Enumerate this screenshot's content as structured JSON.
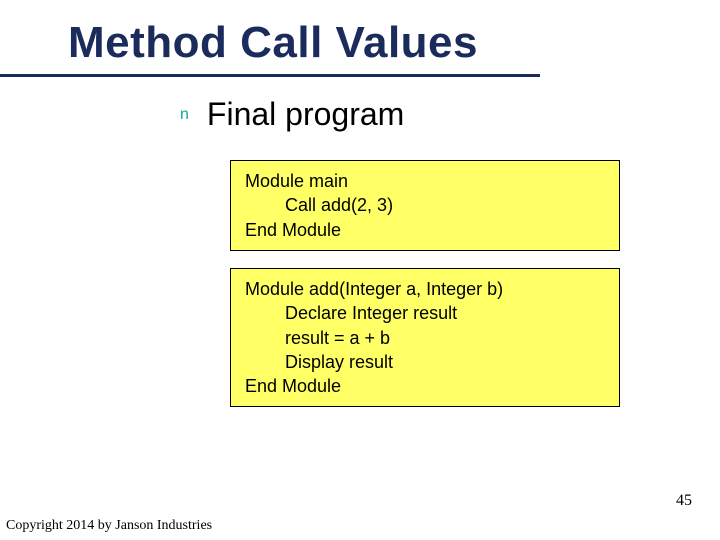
{
  "title": "Method Call Values",
  "bullet": {
    "marker": "n",
    "text": "Final program"
  },
  "code_blocks": [
    "Module main\n        Call add(2, 3)\nEnd Module",
    "Module add(Integer a, Integer b)\n        Declare Integer result\n        result = a + b\n        Display result\nEnd Module"
  ],
  "page_number": "45",
  "copyright": "Copyright 2014 by Janson Industries"
}
